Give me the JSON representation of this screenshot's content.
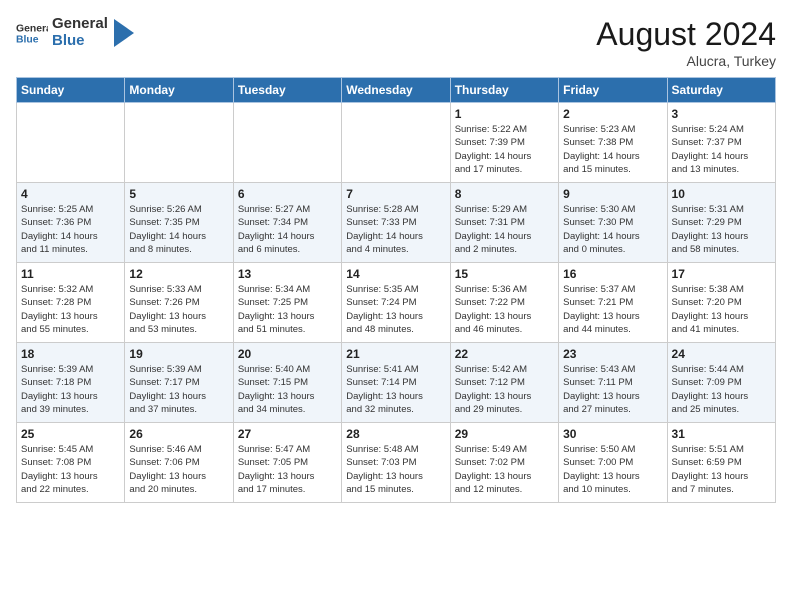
{
  "header": {
    "logo_general": "General",
    "logo_blue": "Blue",
    "month_year": "August 2024",
    "location": "Alucra, Turkey"
  },
  "days_of_week": [
    "Sunday",
    "Monday",
    "Tuesday",
    "Wednesday",
    "Thursday",
    "Friday",
    "Saturday"
  ],
  "weeks": [
    [
      {
        "day": "",
        "detail": ""
      },
      {
        "day": "",
        "detail": ""
      },
      {
        "day": "",
        "detail": ""
      },
      {
        "day": "",
        "detail": ""
      },
      {
        "day": "1",
        "detail": "Sunrise: 5:22 AM\nSunset: 7:39 PM\nDaylight: 14 hours\nand 17 minutes."
      },
      {
        "day": "2",
        "detail": "Sunrise: 5:23 AM\nSunset: 7:38 PM\nDaylight: 14 hours\nand 15 minutes."
      },
      {
        "day": "3",
        "detail": "Sunrise: 5:24 AM\nSunset: 7:37 PM\nDaylight: 14 hours\nand 13 minutes."
      }
    ],
    [
      {
        "day": "4",
        "detail": "Sunrise: 5:25 AM\nSunset: 7:36 PM\nDaylight: 14 hours\nand 11 minutes."
      },
      {
        "day": "5",
        "detail": "Sunrise: 5:26 AM\nSunset: 7:35 PM\nDaylight: 14 hours\nand 8 minutes."
      },
      {
        "day": "6",
        "detail": "Sunrise: 5:27 AM\nSunset: 7:34 PM\nDaylight: 14 hours\nand 6 minutes."
      },
      {
        "day": "7",
        "detail": "Sunrise: 5:28 AM\nSunset: 7:33 PM\nDaylight: 14 hours\nand 4 minutes."
      },
      {
        "day": "8",
        "detail": "Sunrise: 5:29 AM\nSunset: 7:31 PM\nDaylight: 14 hours\nand 2 minutes."
      },
      {
        "day": "9",
        "detail": "Sunrise: 5:30 AM\nSunset: 7:30 PM\nDaylight: 14 hours\nand 0 minutes."
      },
      {
        "day": "10",
        "detail": "Sunrise: 5:31 AM\nSunset: 7:29 PM\nDaylight: 13 hours\nand 58 minutes."
      }
    ],
    [
      {
        "day": "11",
        "detail": "Sunrise: 5:32 AM\nSunset: 7:28 PM\nDaylight: 13 hours\nand 55 minutes."
      },
      {
        "day": "12",
        "detail": "Sunrise: 5:33 AM\nSunset: 7:26 PM\nDaylight: 13 hours\nand 53 minutes."
      },
      {
        "day": "13",
        "detail": "Sunrise: 5:34 AM\nSunset: 7:25 PM\nDaylight: 13 hours\nand 51 minutes."
      },
      {
        "day": "14",
        "detail": "Sunrise: 5:35 AM\nSunset: 7:24 PM\nDaylight: 13 hours\nand 48 minutes."
      },
      {
        "day": "15",
        "detail": "Sunrise: 5:36 AM\nSunset: 7:22 PM\nDaylight: 13 hours\nand 46 minutes."
      },
      {
        "day": "16",
        "detail": "Sunrise: 5:37 AM\nSunset: 7:21 PM\nDaylight: 13 hours\nand 44 minutes."
      },
      {
        "day": "17",
        "detail": "Sunrise: 5:38 AM\nSunset: 7:20 PM\nDaylight: 13 hours\nand 41 minutes."
      }
    ],
    [
      {
        "day": "18",
        "detail": "Sunrise: 5:39 AM\nSunset: 7:18 PM\nDaylight: 13 hours\nand 39 minutes."
      },
      {
        "day": "19",
        "detail": "Sunrise: 5:39 AM\nSunset: 7:17 PM\nDaylight: 13 hours\nand 37 minutes."
      },
      {
        "day": "20",
        "detail": "Sunrise: 5:40 AM\nSunset: 7:15 PM\nDaylight: 13 hours\nand 34 minutes."
      },
      {
        "day": "21",
        "detail": "Sunrise: 5:41 AM\nSunset: 7:14 PM\nDaylight: 13 hours\nand 32 minutes."
      },
      {
        "day": "22",
        "detail": "Sunrise: 5:42 AM\nSunset: 7:12 PM\nDaylight: 13 hours\nand 29 minutes."
      },
      {
        "day": "23",
        "detail": "Sunrise: 5:43 AM\nSunset: 7:11 PM\nDaylight: 13 hours\nand 27 minutes."
      },
      {
        "day": "24",
        "detail": "Sunrise: 5:44 AM\nSunset: 7:09 PM\nDaylight: 13 hours\nand 25 minutes."
      }
    ],
    [
      {
        "day": "25",
        "detail": "Sunrise: 5:45 AM\nSunset: 7:08 PM\nDaylight: 13 hours\nand 22 minutes."
      },
      {
        "day": "26",
        "detail": "Sunrise: 5:46 AM\nSunset: 7:06 PM\nDaylight: 13 hours\nand 20 minutes."
      },
      {
        "day": "27",
        "detail": "Sunrise: 5:47 AM\nSunset: 7:05 PM\nDaylight: 13 hours\nand 17 minutes."
      },
      {
        "day": "28",
        "detail": "Sunrise: 5:48 AM\nSunset: 7:03 PM\nDaylight: 13 hours\nand 15 minutes."
      },
      {
        "day": "29",
        "detail": "Sunrise: 5:49 AM\nSunset: 7:02 PM\nDaylight: 13 hours\nand 12 minutes."
      },
      {
        "day": "30",
        "detail": "Sunrise: 5:50 AM\nSunset: 7:00 PM\nDaylight: 13 hours\nand 10 minutes."
      },
      {
        "day": "31",
        "detail": "Sunrise: 5:51 AM\nSunset: 6:59 PM\nDaylight: 13 hours\nand 7 minutes."
      }
    ]
  ]
}
